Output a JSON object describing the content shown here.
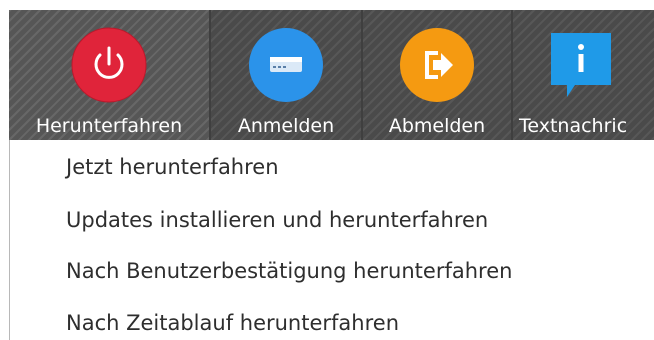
{
  "toolbar": {
    "items": [
      {
        "label": "Herunterfahren",
        "icon": "power-icon",
        "color": "#e0243a",
        "selected": true
      },
      {
        "label": "Anmelden",
        "icon": "login-card-icon",
        "color": "#2b93ea"
      },
      {
        "label": "Abmelden",
        "icon": "logout-arrow-icon",
        "color": "#f59a11"
      },
      {
        "label": "Textnachric",
        "icon": "info-message-icon",
        "color": "#1f9ae8"
      }
    ]
  },
  "menu": {
    "items": [
      {
        "label": "Jetzt herunterfahren"
      },
      {
        "label": "Updates installieren und herunterfahren"
      },
      {
        "label": "Nach Benutzerbestätigung herunterfahren"
      },
      {
        "label": "Nach Zeitablauf herunterfahren"
      }
    ]
  }
}
